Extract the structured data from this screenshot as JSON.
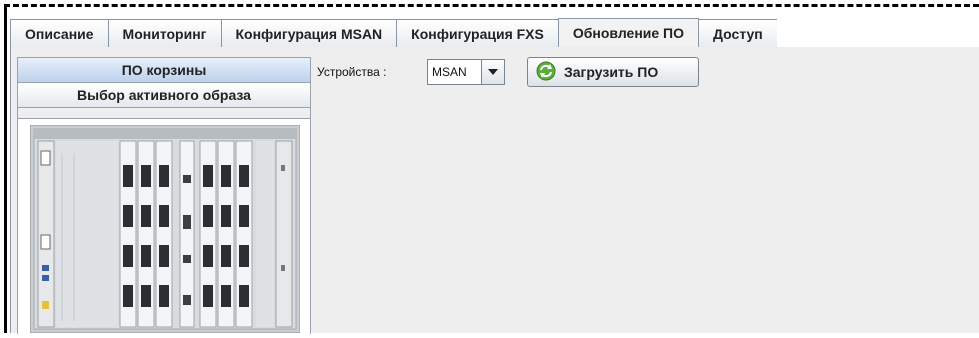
{
  "tabs": [
    {
      "label": "Описание",
      "active": false
    },
    {
      "label": "Мониторинг",
      "active": false
    },
    {
      "label": "Конфигурация MSAN",
      "active": false
    },
    {
      "label": "Конфигурация FXS",
      "active": false
    },
    {
      "label": "Обновление ПО",
      "active": true
    },
    {
      "label": "Доступ",
      "active": false
    }
  ],
  "sidebar": {
    "items": [
      {
        "label": "ПО корзины",
        "selected": true
      },
      {
        "label": "Выбор активного образа",
        "selected": false
      }
    ],
    "image": "msan-chassis-image"
  },
  "main": {
    "device_label": "Устройства :",
    "device_select": {
      "value": "MSAN"
    },
    "upload_button": {
      "label": "Загрузить ПО",
      "icon": "refresh-icon"
    }
  },
  "colors": {
    "accent_selected": "#bcd1ec",
    "panel_bg": "#eeeeee",
    "border": "#8a96a3"
  }
}
